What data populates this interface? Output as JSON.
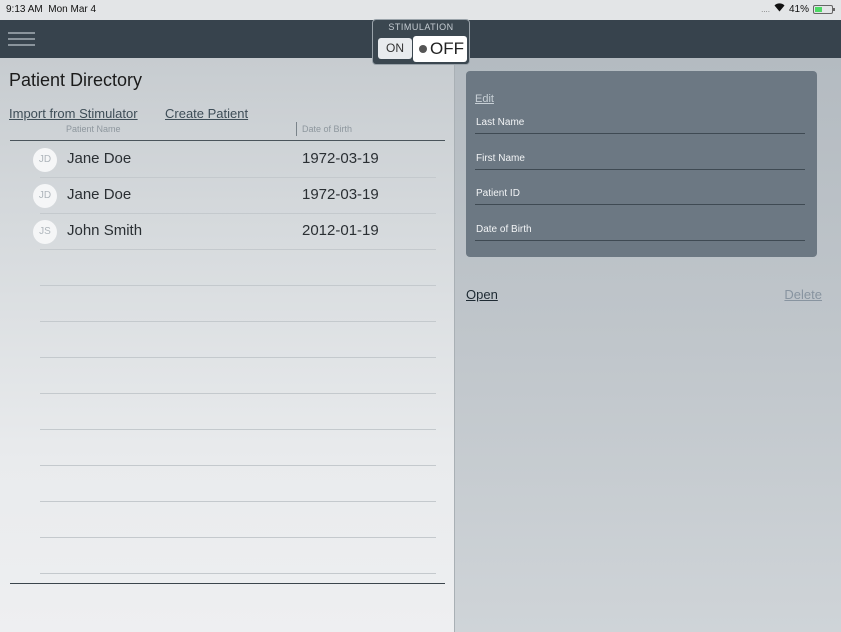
{
  "status_bar": {
    "time": "9:13 AM",
    "date": "Mon Mar 4",
    "signal": "....",
    "wifi_icon": "wifi-icon",
    "battery_pct": "41%",
    "battery_level": 0.41
  },
  "nav": {
    "menu_icon": "hamburger-menu-icon",
    "stimulation": {
      "label": "STIMULATION",
      "on_label": "ON",
      "off_label": "OFF",
      "state": "OFF"
    }
  },
  "directory": {
    "title": "Patient Directory",
    "import_label": "Import from Stimulator",
    "create_label": "Create Patient",
    "columns": {
      "name": "Patient Name",
      "dob": "Date of Birth"
    },
    "patients": [
      {
        "initials": "JD",
        "name": "Jane Doe",
        "dob": "1972-03-19"
      },
      {
        "initials": "JD",
        "name": "Jane Doe",
        "dob": "1972-03-19"
      },
      {
        "initials": "JS",
        "name": "John Smith",
        "dob": "2012-01-19"
      }
    ]
  },
  "detail": {
    "edit_label": "Edit",
    "fields": {
      "last_name": "Last Name",
      "first_name": "First Name",
      "patient_id": "Patient ID",
      "dob": "Date of Birth"
    },
    "open_label": "Open",
    "delete_label": "Delete"
  },
  "colors": {
    "nav_bar": "#37434d",
    "detail_card": "#6c7883",
    "battery_charging": "#4cd964"
  }
}
